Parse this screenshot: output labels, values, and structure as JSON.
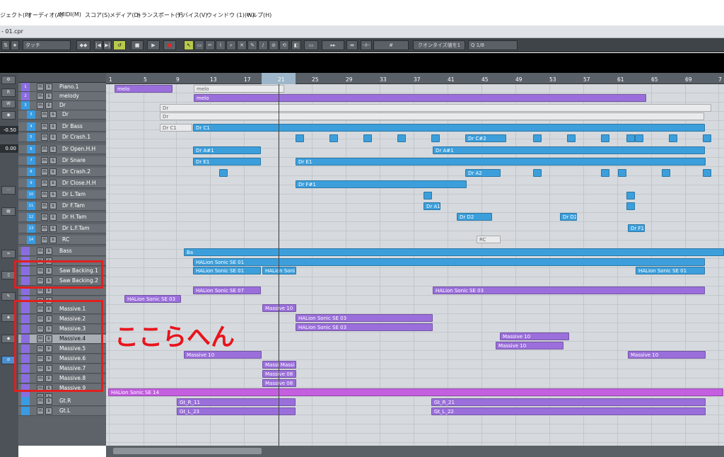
{
  "menu": [
    "ジェクト(P)",
    "オーディオ(A)",
    "MIDI(M)",
    "スコア(S)",
    "メディア(D)",
    "トランスポート(T)",
    "デバイス(V)",
    "ウィンドウ (1)(W)",
    "ヘルプ(H)"
  ],
  "window": {
    "title": "- 01.cpr"
  },
  "toolbar": {
    "touch_mode": "タッチ",
    "quantize_label": "クオンタイズ値を1",
    "quantize_prefix": "Q",
    "quantize_value": "1/8"
  },
  "left_values": [
    "-0.50",
    "0.00"
  ],
  "ruler_ticks": [
    "1",
    "5",
    "9",
    "13",
    "17",
    "21",
    "25",
    "29",
    "33",
    "37",
    "41",
    "45",
    "49",
    "53",
    "57",
    "61",
    "65",
    "69",
    "7"
  ],
  "tracks": [
    {
      "num": "1",
      "name": "Piano.1",
      "type": "synth"
    },
    {
      "num": "2",
      "name": "melody",
      "type": "synth"
    },
    {
      "num": "3",
      "name": "Dr",
      "type": "folder"
    },
    {
      "num": "3",
      "name": "Dr",
      "type": "child"
    },
    {
      "num": "4",
      "name": "Dr Bass",
      "type": "child"
    },
    {
      "num": "5",
      "name": "Dr Crash.1",
      "type": "child"
    },
    {
      "num": "6",
      "name": "Dr Open.H.H",
      "type": "child"
    },
    {
      "num": "7",
      "name": "Dr Snare",
      "type": "child"
    },
    {
      "num": "8",
      "name": "Dr Crash.2",
      "type": "child"
    },
    {
      "num": "9",
      "name": "Dr Close.H.H",
      "type": "child"
    },
    {
      "num": "10",
      "name": "Dr L.Tam",
      "type": "child"
    },
    {
      "num": "11",
      "name": "Dr F.Tam",
      "type": "child"
    },
    {
      "num": "12",
      "name": "Dr H.Tam",
      "type": "child"
    },
    {
      "num": "13",
      "name": "Dr L.F.Tam",
      "type": "child"
    },
    {
      "num": "14",
      "name": "RC",
      "type": "child"
    },
    {
      "num": "",
      "name": "Bass",
      "type": "synth"
    },
    {
      "num": "",
      "name": "",
      "type": "synth"
    },
    {
      "num": "",
      "name": "Saw Backing.1",
      "type": "synth"
    },
    {
      "num": "",
      "name": "Saw Backing.2",
      "type": "synth"
    },
    {
      "num": "",
      "name": "",
      "type": "synth"
    },
    {
      "num": "",
      "name": "",
      "type": "synth"
    },
    {
      "num": "",
      "name": "Massive.1",
      "type": "synth"
    },
    {
      "num": "",
      "name": "Massive.2",
      "type": "synth"
    },
    {
      "num": "",
      "name": "Massive.3",
      "type": "synth"
    },
    {
      "num": "",
      "name": "Massive.4",
      "type": "synth",
      "selected": true
    },
    {
      "num": "",
      "name": "Massive.5",
      "type": "synth"
    },
    {
      "num": "",
      "name": "Massive.6",
      "type": "synth"
    },
    {
      "num": "",
      "name": "Massive.7",
      "type": "synth"
    },
    {
      "num": "",
      "name": "Massive.8",
      "type": "synth"
    },
    {
      "num": "",
      "name": "Massive.9",
      "type": "synth"
    },
    {
      "num": "",
      "name": "",
      "type": "synth"
    },
    {
      "num": "",
      "name": "Gt.R",
      "type": "audio"
    },
    {
      "num": "",
      "name": "Gt.L",
      "type": "audio"
    }
  ],
  "events": {
    "melo1": "melo",
    "melo2": "melo",
    "melo3": "melo",
    "dr1": "Dr",
    "dr2": "Dr",
    "drc1a": "Dr C1",
    "drc1b": "Dr C1",
    "drcs2": "Dr C#2",
    "draa1": "Dr A#1",
    "draa2": "Dr A#1",
    "dre1a": "Dr E1",
    "dre1b": "Dr E1",
    "dra2": "Dr A2",
    "drf1": "Dr F#1",
    "dra1": "Dr A1",
    "drd2a": "Dr D2",
    "drd2b": "Dr D2",
    "drf1b": "Dr F1",
    "rc": "RC",
    "ba": "Ba",
    "h01a": "HALion Sonic SE 01",
    "h01b": "HALion Sonic SE 01",
    "h01c": "HALion Sonic SE 01",
    "hal": "HALion Soni",
    "h07": "HALion Sonic SE 07",
    "h03a": "HALion Sonic SE 03",
    "h03b": "HALion Sonic SE 03",
    "m10a": "Massive 10",
    "h03c": "HALion Sonic SE 03",
    "h03d": "HALion Sonic SE 03",
    "m10b": "Massive 10",
    "m10c": "Massive 10",
    "m10d": "Massive 10",
    "m10e": "Massive 10",
    "massi": "Massi Massi",
    "m08a": "Massive 08",
    "m08b": "Massive 08",
    "h14": "HALion Sonic SE 14",
    "gr11": "Gt_R_11",
    "gr21": "Gt_R_21",
    "gl23": "Gt_L_23",
    "gl22": "Gt_L_22"
  },
  "annotation": "ここらへん"
}
